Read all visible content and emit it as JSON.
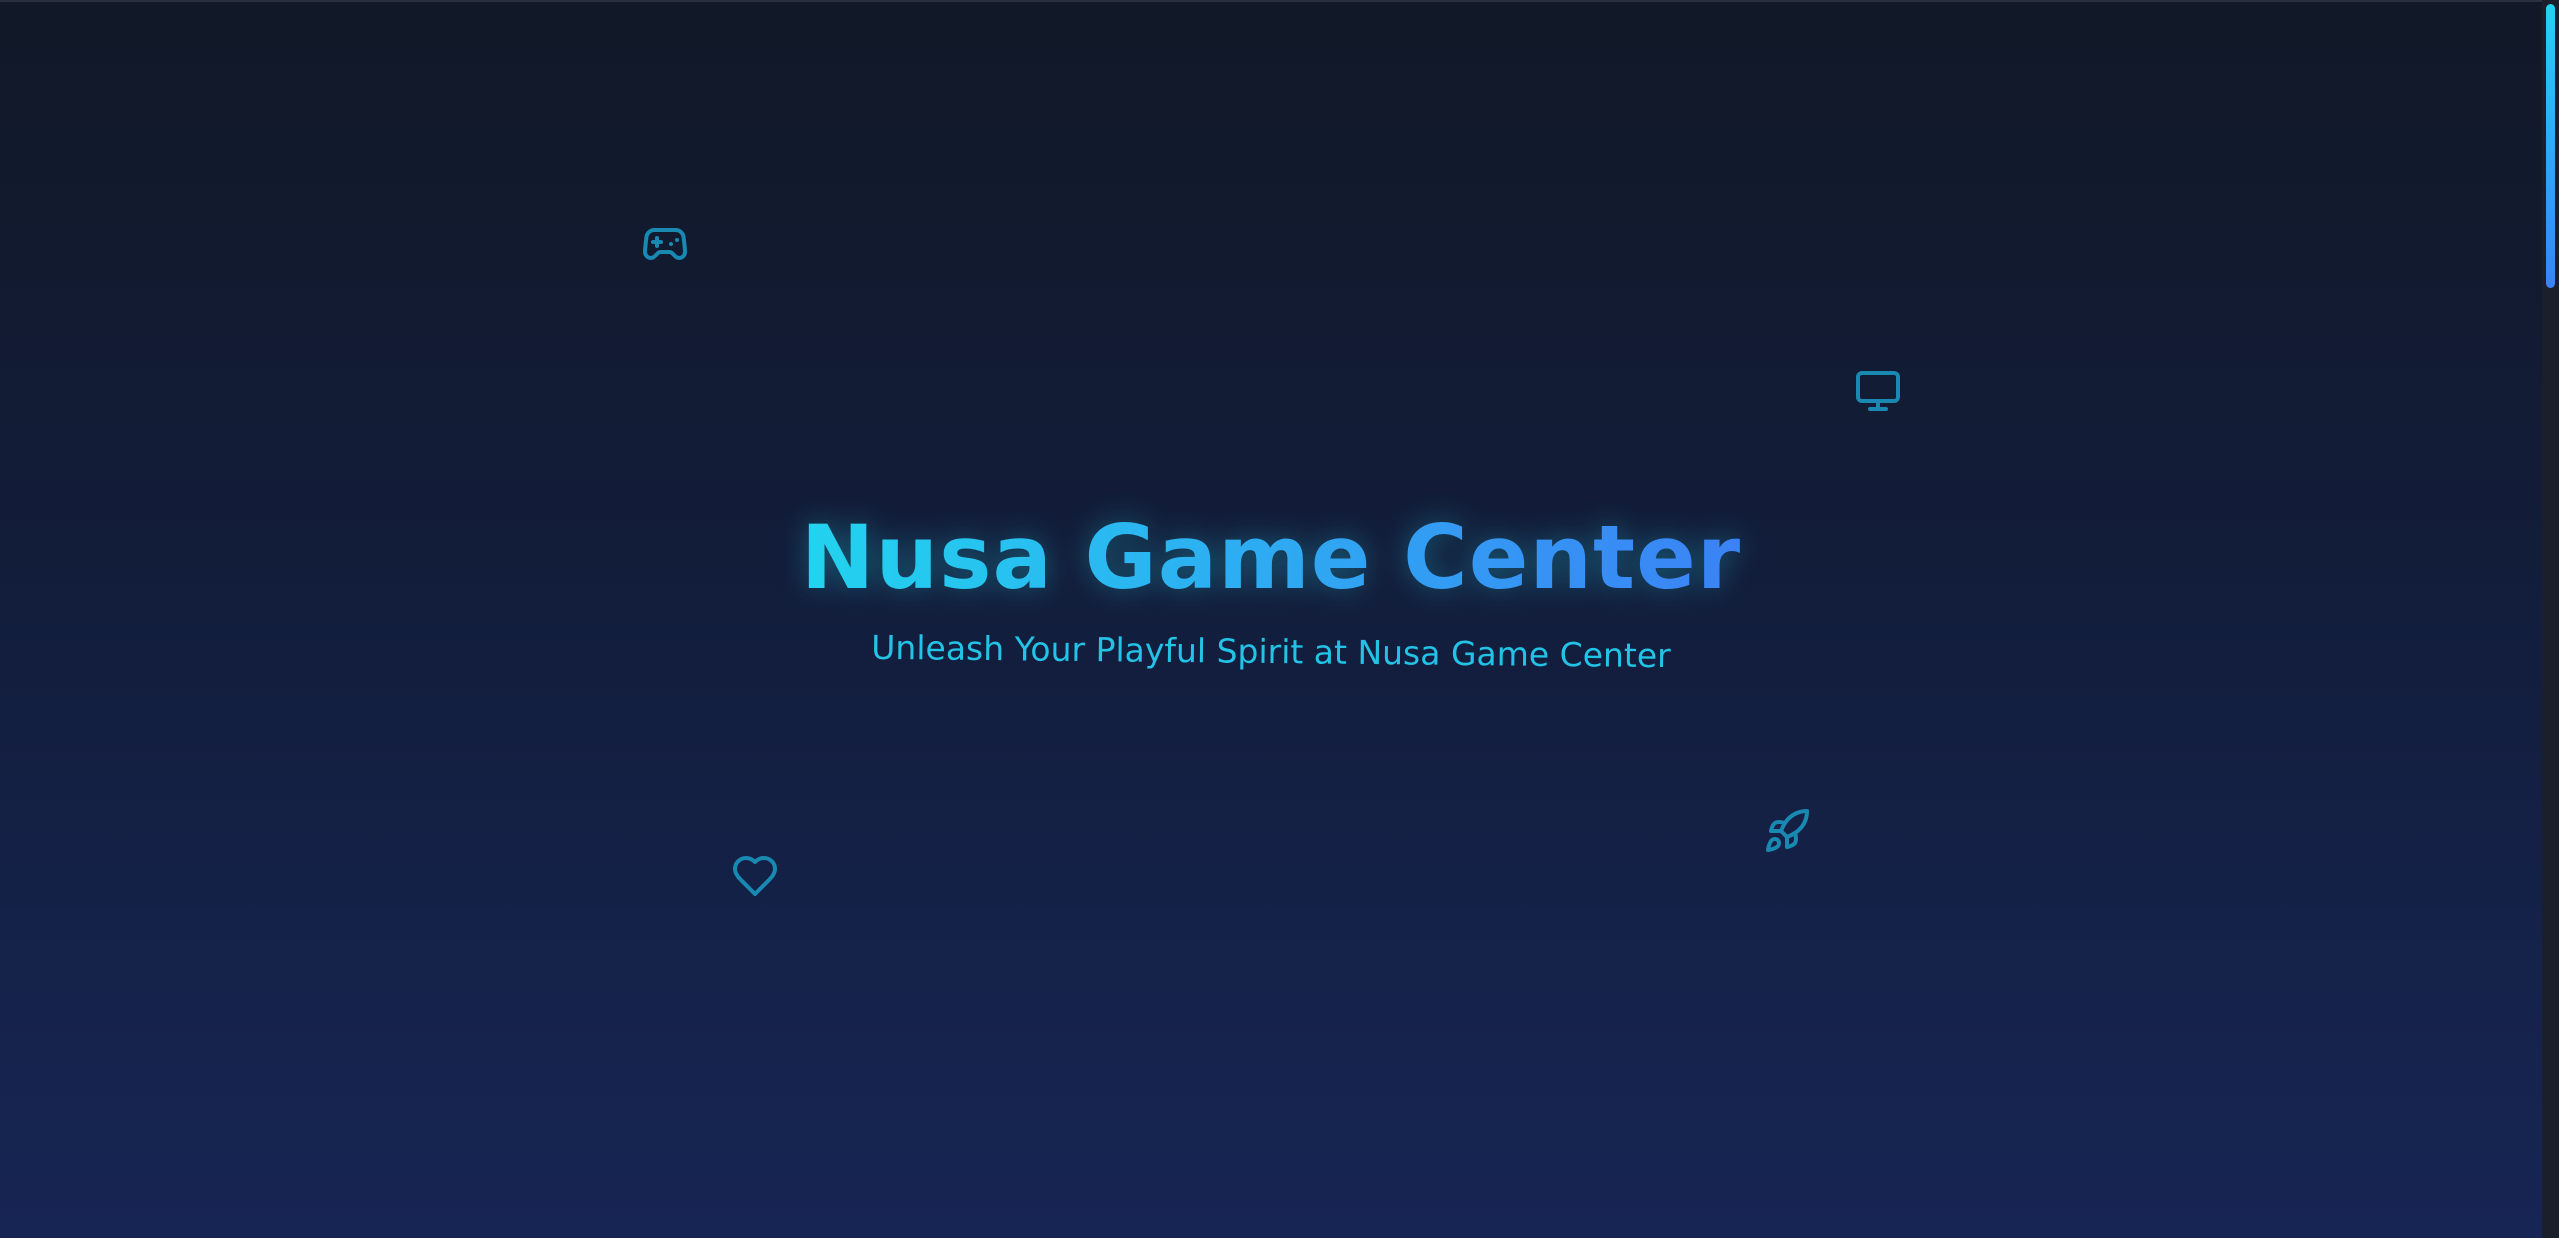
{
  "hero": {
    "title": "Nusa Game Center",
    "subtitle": "Unleash Your Playful Spirit at Nusa Game Center"
  },
  "decorations": {
    "icons": [
      "gamepad-icon",
      "monitor-icon",
      "heart-icon",
      "rocket-icon"
    ]
  },
  "colors": {
    "background_top": "#111827",
    "background_bottom": "#172554",
    "accent_cyan": "#22d3ee",
    "accent_blue": "#3b82f6",
    "icon_color": "#1a8fb8"
  }
}
